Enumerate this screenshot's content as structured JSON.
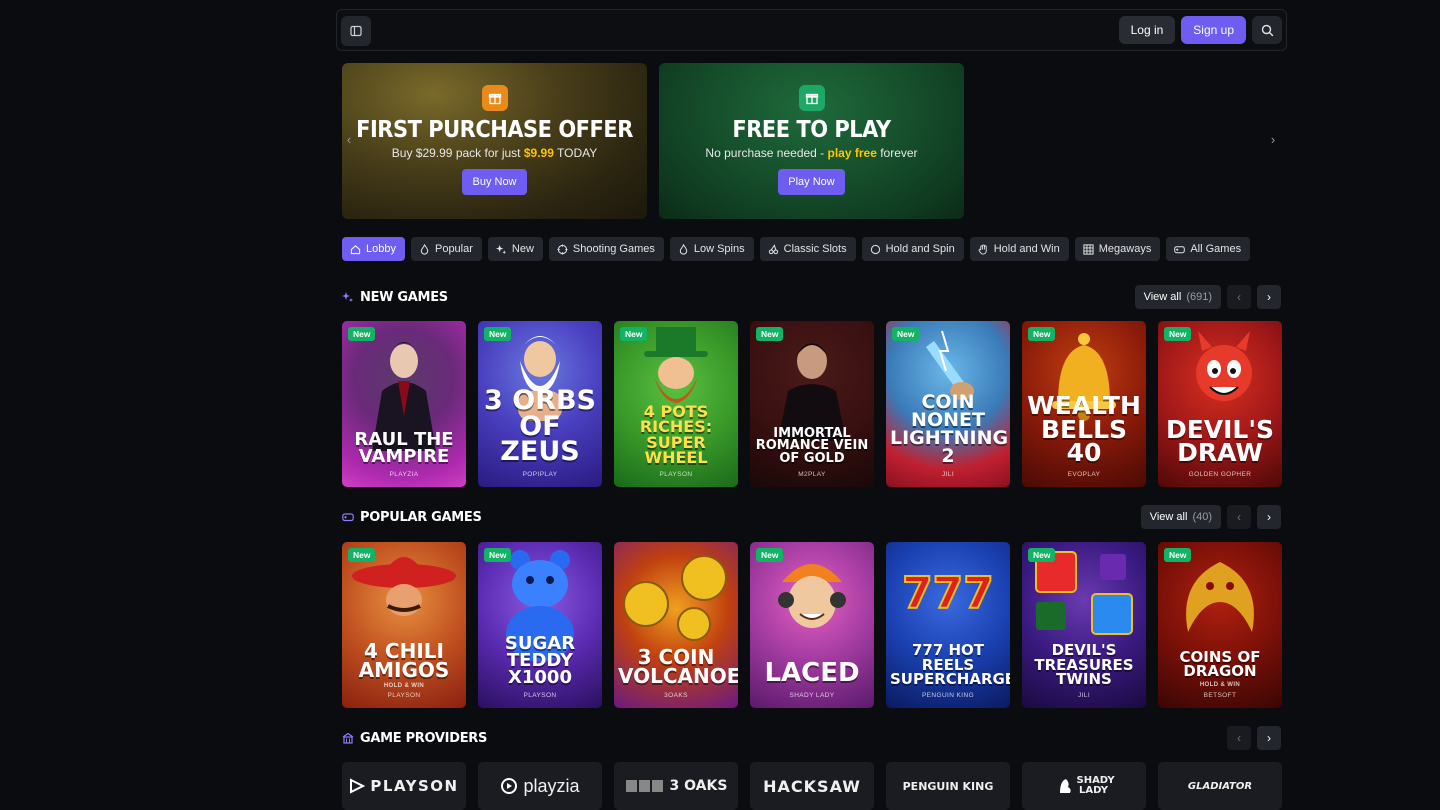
{
  "header": {
    "login_label": "Log in",
    "signup_label": "Sign up"
  },
  "banners": [
    {
      "title": "FIRST PURCHASE OFFER",
      "text_before": "Buy $29.99 pack for just ",
      "highlight": "$9.99",
      "text_after": " TODAY",
      "cta": "Buy Now"
    },
    {
      "title": "FREE TO PLAY",
      "text_before": "No purchase needed - ",
      "highlight": "play free",
      "text_after": " forever",
      "cta": "Play Now"
    }
  ],
  "tabs": [
    {
      "label": "Lobby",
      "icon": "home-icon"
    },
    {
      "label": "Popular",
      "icon": "flame-icon"
    },
    {
      "label": "New",
      "icon": "sparkle-icon"
    },
    {
      "label": "Shooting Games",
      "icon": "crosshair-icon"
    },
    {
      "label": "Low Spins",
      "icon": "flame-icon"
    },
    {
      "label": "Classic Slots",
      "icon": "cherries-icon"
    },
    {
      "label": "Hold and Spin",
      "icon": "circle-icon"
    },
    {
      "label": "Hold and Win",
      "icon": "hand-icon"
    },
    {
      "label": "Megaways",
      "icon": "grid-icon"
    },
    {
      "label": "All Games",
      "icon": "gamepad-icon"
    }
  ],
  "new_games": {
    "title": "NEW GAMES",
    "view_all": "View all",
    "count": "(691)",
    "games": [
      {
        "title": "RAUL THE VAMPIRE",
        "provider": "PLAYZIA",
        "badge": "New"
      },
      {
        "title": "3 ORBS OF ZEUS",
        "provider": "POPIPLAY",
        "badge": "New"
      },
      {
        "title": "4 POTS RICHES: SUPER WHEEL",
        "provider": "PLAYSON",
        "badge": "New"
      },
      {
        "title": "IMMORTAL ROMANCE VEIN OF GOLD",
        "provider": "M2PLAY",
        "badge": "New"
      },
      {
        "title": "COIN NONET LIGHTNING 2",
        "provider": "JILI",
        "badge": "New"
      },
      {
        "title": "WEALTH BELLS 40",
        "provider": "EVOPLAY",
        "badge": "New"
      },
      {
        "title": "DEVIL'S DRAW",
        "provider": "GOLDEN GOPHER",
        "badge": "New"
      }
    ]
  },
  "popular_games": {
    "title": "POPULAR GAMES",
    "view_all": "View all",
    "count": "(40)",
    "games": [
      {
        "title": "4 CHILI AMIGOS",
        "subtitle": "HOLD & WIN",
        "provider": "PLAYSON",
        "badge": "New"
      },
      {
        "title": "SUGAR TEDDY X1000",
        "provider": "PLAYSON",
        "badge": "New"
      },
      {
        "title": "3 COIN VOLCANOES",
        "provider": "3OAKS",
        "badge": ""
      },
      {
        "title": "LACED",
        "provider": "SHADY LADY",
        "badge": "New"
      },
      {
        "title": "777 HOT REELS SUPERCHARGED",
        "provider": "PENGUIN KING",
        "badge": ""
      },
      {
        "title": "DEVIL'S TREASURES TWINS",
        "provider": "JILI",
        "badge": "New"
      },
      {
        "title": "COINS OF DRAGON",
        "subtitle": "HOLD & WIN",
        "provider": "BETSOFT",
        "badge": "New"
      }
    ]
  },
  "providers": {
    "title": "GAME PROVIDERS",
    "items": [
      "PLAYSON",
      "playzia",
      "3 OAKS",
      "HACKSAW",
      "PENGUIN KING",
      "SHADY LADY",
      "GLADIATOR"
    ]
  },
  "colors": {
    "accent": "#6f5cf0",
    "new_badge": "#12b364",
    "highlight": "#ffc400",
    "background": "#0b0c10"
  }
}
